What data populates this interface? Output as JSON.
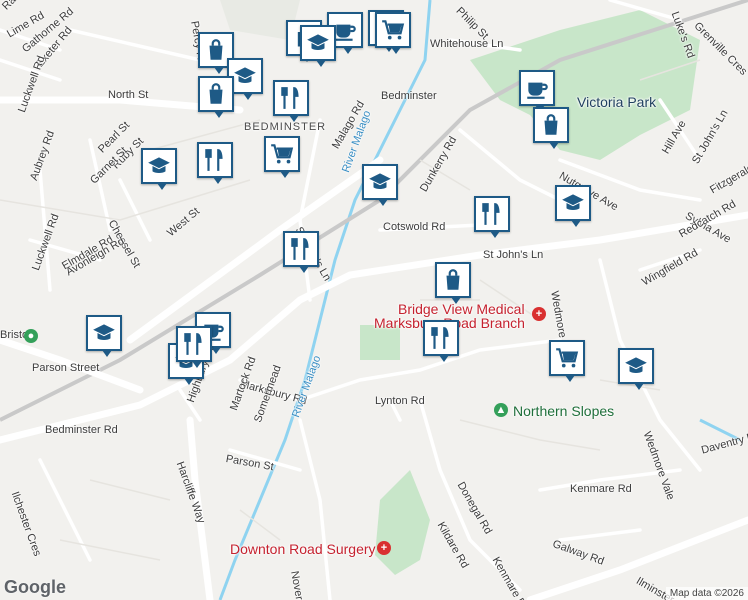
{
  "map": {
    "street_labels": [
      "Raleigh Rd",
      "Lime Rd",
      "Gathorne Rd",
      "Exeter Rd",
      "North St",
      "Luckwell Rd",
      "Pearl St",
      "Ruby St",
      "Garnet St",
      "Aubrey Rd",
      "Chessel St",
      "Elmdale Rd",
      "Avonleigh Rd",
      "Luckwell Rd",
      "West St",
      "Malago Rd",
      "St John's Ln",
      "St John's Ln",
      "Cotswold Rd",
      "Dunkerry Rd",
      "Nutgrove Ave",
      "Hill Ave",
      "St John's Ln",
      "Fitzgerald Rd",
      "Sylvia Ave",
      "Redcatch Rd",
      "Wingfield Rd",
      "Wedmore Vale",
      "Marksbury Rd",
      "Highbury Rd",
      "Martock Rd",
      "Somermead",
      "Lynton Rd",
      "Parson St",
      "Bedminster Rd",
      "Bedminster Rd",
      "Harcliffe Way",
      "Ilchester Cres",
      "Donegal Rd",
      "Kildare Rd",
      "Kenmare Rd",
      "Galway Rd",
      "Kenmare Rd",
      "Ilminster Ave",
      "Daventry Rd",
      "Wedmore Vale",
      "Novers Ln",
      "Whitehouse Ln",
      "Philip St",
      "Luke's Rd",
      "Grenville Cres",
      "Percy Rd"
    ],
    "area_label": "BEDMINSTER",
    "station_labels": [
      "Parson Street",
      "Bedminster",
      "Bristol"
    ],
    "park_labels": [
      "Victoria Park",
      "Northern Slopes"
    ],
    "river_labels": [
      "River Malago",
      "River Malago"
    ],
    "medical_labels": [
      "Bridge View Medical",
      "Marksbury Road Branch",
      "Downton Road Surgery"
    ],
    "google": "Google",
    "attribution": "Map data ©2026",
    "pin_icons": [
      "shopping-bag-icon",
      "coffee-icon",
      "graduation-cap-icon",
      "parking-icon",
      "cart-icon",
      "shopping-bag-icon",
      "restaurant-icon",
      "graduation-cap-icon",
      "cart-icon",
      "restaurant-icon",
      "coffee-icon",
      "graduation-cap-icon",
      "restaurant-icon",
      "graduation-cap-icon",
      "shopping-bag-icon",
      "restaurant-icon",
      "graduation-cap-icon",
      "shopping-bag-icon",
      "restaurant-icon",
      "cart-icon",
      "graduation-cap-icon",
      "graduation-cap-icon",
      "coffee-icon",
      "restaurant-icon",
      "graduation-cap-icon",
      "cart-icon"
    ],
    "colors": {
      "pin_border": "#1e5a86",
      "park": "#c8e6c9",
      "river": "#8fd3f0",
      "medical": "#d93030",
      "park_poi": "#34a05a"
    }
  }
}
